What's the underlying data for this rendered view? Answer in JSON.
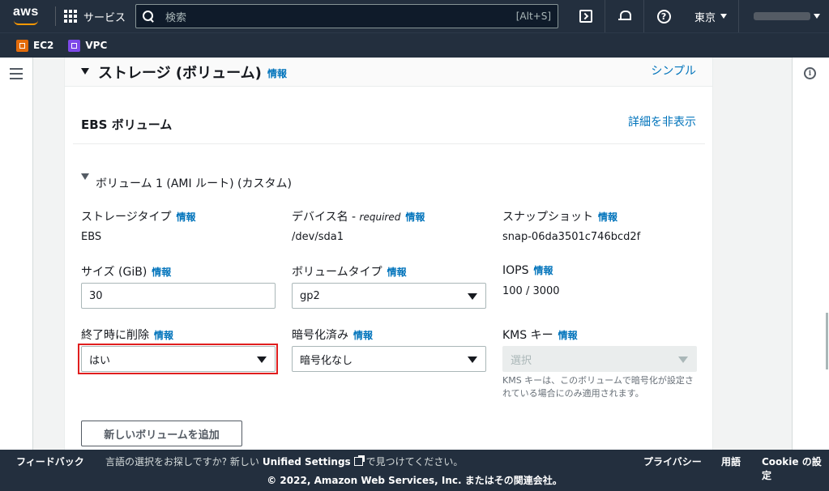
{
  "topnav": {
    "logo": "aws",
    "services_label": "サービス",
    "search_placeholder": "検索",
    "search_shortcut": "[Alt+S]",
    "help_glyph": "?",
    "region": "東京"
  },
  "favorites": [
    {
      "label": "EC2",
      "color": "#e26b0a"
    },
    {
      "label": "VPC",
      "color": "#7d48e8"
    }
  ],
  "storage": {
    "title": "ストレージ (ボリューム)",
    "info": "情報",
    "simple_link": "シンプル",
    "ebs_title": "EBS ボリューム",
    "detail_link": "詳細を非表示",
    "volume_title": "ボリューム 1 (AMI ルート) (カスタム)",
    "storage_type": {
      "label": "ストレージタイプ",
      "info": "情報",
      "value": "EBS"
    },
    "device_name": {
      "label": "デバイス名 - ",
      "required": "required",
      "info": "情報",
      "value": "/dev/sda1"
    },
    "snapshot": {
      "label": "スナップショット",
      "info": "情報",
      "value": "snap-06da3501c746bcd2f"
    },
    "size": {
      "label": "サイズ (GiB)",
      "info": "情報",
      "value": "30"
    },
    "volume_type": {
      "label": "ボリュームタイプ",
      "info": "情報",
      "value": "gp2"
    },
    "iops": {
      "label": "IOPS",
      "info": "情報",
      "value": "100 / 3000"
    },
    "delete_on_termination": {
      "label": "終了時に削除",
      "info": "情報",
      "value": "はい"
    },
    "encrypted": {
      "label": "暗号化済み",
      "info": "情報",
      "value": "暗号化なし"
    },
    "kms_key": {
      "label": "KMS キー",
      "info": "情報",
      "placeholder": "選択",
      "hint": "KMS キーは、このボリュームで暗号化が設定されている場合にのみ適用されます。"
    },
    "add_volume_button": "新しいボリュームを追加"
  },
  "footer": {
    "feedback": "フィードバック",
    "language_prompt": "言語の選択をお探しですか? 新しい",
    "unified_settings": "Unified Settings",
    "language_suffix": "で見つけてください。",
    "privacy": "プライバシー",
    "terms": "用語",
    "cookie": "Cookie の設定",
    "copyright": "© 2022, Amazon Web Services, Inc. またはその関連会社。"
  },
  "colors": {
    "nav_bg": "#232f3e",
    "link": "#0073bb",
    "highlight": "#e01e1e",
    "aws_orange": "#ff9900"
  }
}
